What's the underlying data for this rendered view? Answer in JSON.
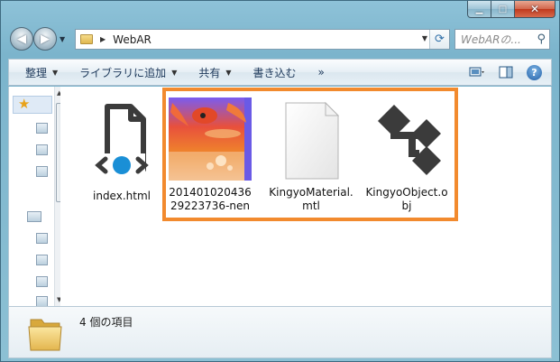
{
  "window": {
    "controls": {
      "minimize": "▁",
      "maximize": "□",
      "close": "✕"
    }
  },
  "nav": {
    "back": "◀",
    "forward": "▶",
    "dropdown": "▼"
  },
  "address": {
    "separator": "▶",
    "path": "WebAR",
    "dropdown": "▼",
    "refresh": "⟳"
  },
  "search": {
    "placeholder": "WebARの...",
    "icon": "⚲"
  },
  "toolbar": {
    "items": [
      {
        "label": "整理",
        "arrow": "▼"
      },
      {
        "label": "ライブラリに追加",
        "arrow": "▼"
      },
      {
        "label": "共有",
        "arrow": "▼"
      },
      {
        "label": "書き込む"
      },
      {
        "label": "»"
      }
    ],
    "help": "?"
  },
  "files": [
    {
      "name": "index.html"
    },
    {
      "name": "20140102043629223736-nen"
    },
    {
      "name": "KingyoMaterial.mtl"
    },
    {
      "name": "KingyoObject.obj"
    }
  ],
  "status": {
    "count_text": "4 個の項目"
  },
  "colors": {
    "highlight": "#f28a2e",
    "html_dot": "#1a8fd6",
    "obj_icon": "#3b3b3b"
  }
}
